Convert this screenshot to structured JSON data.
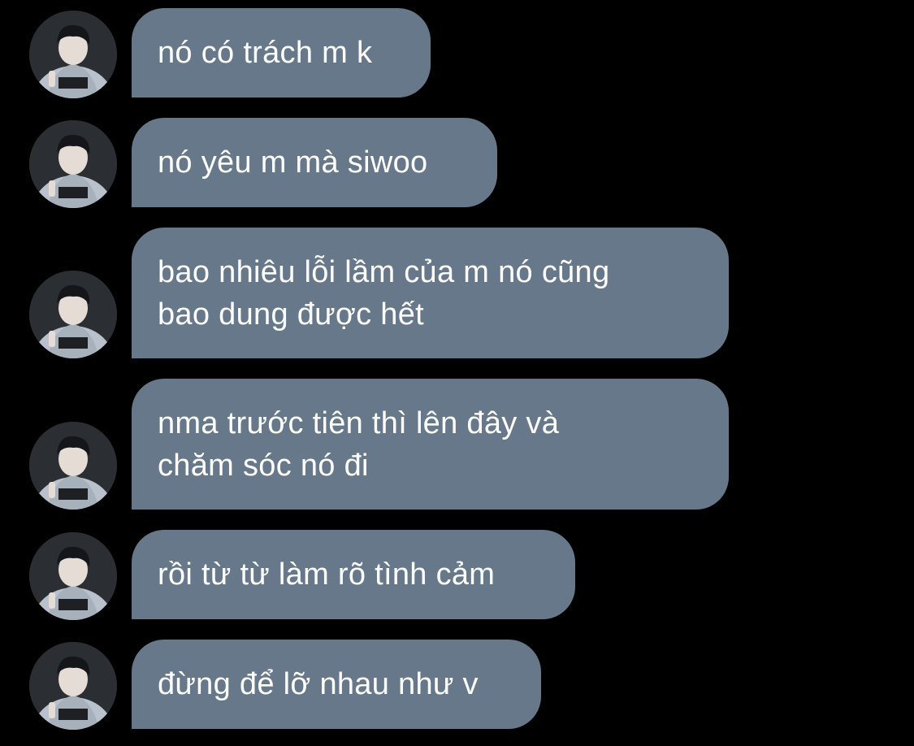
{
  "messages": [
    {
      "text": "nó có trách m k"
    },
    {
      "text": "nó yêu m mà siwoo"
    },
    {
      "text": "bao nhiêu lỗi lầm của m nó cũng\nbao dung được hết"
    },
    {
      "text": "nma trước tiên thì lên đây và\nchăm sóc nó đi"
    },
    {
      "text": "rồi từ từ làm rõ tình cảm"
    },
    {
      "text": "đừng để lỡ nhau như v"
    }
  ],
  "colors": {
    "background": "#000000",
    "bubble": "#66788a",
    "text": "#ffffff"
  },
  "avatar_icon": "profile-photo-icon"
}
